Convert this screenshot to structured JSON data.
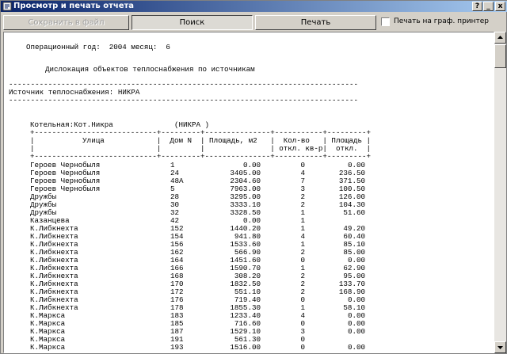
{
  "window": {
    "title": "Просмотр и печать отчета",
    "btn_help": "?",
    "btn_restore": "_",
    "btn_close": "x"
  },
  "toolbar": {
    "save_label": "Сохранить в файл",
    "search_label": "Поиск",
    "print_label": "Печать",
    "graph_printer_label": "Печать на граф. принтер"
  },
  "report": {
    "header_line": "Операционный год:  2004 месяц:  6",
    "title_line": "Дислокация объектов теплоснабжения по источникам",
    "sep_line": "--------------------------------------------------------------------------------",
    "source_line": "Источник теплоснабжения: НИКРА",
    "boiler_line": "Котельная:Кот.Никра              (НИКРА )",
    "table_border": "+----------------------------+---------+---------------+-----------+---------+",
    "table_head1": "|           Улица            |  Дом N  | Площадь, м2   |  Кол-во   | Площадь |",
    "table_head2": "|                            |         |               | откл. кв-р|  откл.  |",
    "rows": [
      [
        "Героев Чернобыля",
        "1",
        "0.00",
        "0",
        "0.00"
      ],
      [
        "Героев Чернобыля",
        "24",
        "3405.00",
        "4",
        "236.50"
      ],
      [
        "Героев Чернобыля",
        "48А",
        "2304.60",
        "7",
        "371.50"
      ],
      [
        "Героев Чернобыля",
        "5",
        "7963.00",
        "3",
        "100.50"
      ],
      [
        "Дружбы",
        "28",
        "3295.00",
        "2",
        "126.00"
      ],
      [
        "Дружбы",
        "30",
        "3333.10",
        "2",
        "104.30"
      ],
      [
        "Дружбы",
        "32",
        "3328.50",
        "1",
        "51.60"
      ],
      [
        "Казанцева",
        "42",
        "0.00",
        "1",
        ""
      ],
      [
        "К.Либкнехта",
        "152",
        "1440.20",
        "1",
        "49.20"
      ],
      [
        "К.Либкнехта",
        "154",
        "941.80",
        "4",
        "60.40"
      ],
      [
        "К.Либкнехта",
        "156",
        "1533.60",
        "1",
        "85.10"
      ],
      [
        "К.Либкнехта",
        "162",
        "566.90",
        "2",
        "85.00"
      ],
      [
        "К.Либкнехта",
        "164",
        "1451.60",
        "0",
        "0.00"
      ],
      [
        "К.Либкнехта",
        "166",
        "1590.70",
        "1",
        "62.90"
      ],
      [
        "К.Либкнехта",
        "168",
        "308.20",
        "2",
        "95.00"
      ],
      [
        "К.Либкнехта",
        "170",
        "1832.50",
        "2",
        "133.70"
      ],
      [
        "К.Либкнехта",
        "172",
        "551.10",
        "2",
        "168.90"
      ],
      [
        "К.Либкнехта",
        "176",
        "719.40",
        "0",
        "0.00"
      ],
      [
        "К.Либкнехта",
        "178",
        "1855.30",
        "1",
        "58.10"
      ],
      [
        "К.Маркса",
        "183",
        "1233.40",
        "4",
        "0.00"
      ],
      [
        "К.Маркса",
        "185",
        "716.60",
        "0",
        "0.00"
      ],
      [
        "К.Маркса",
        "187",
        "1529.10",
        "3",
        "0.00"
      ],
      [
        "К.Маркса",
        "191",
        "561.30",
        "0",
        ""
      ],
      [
        "К.Маркса",
        "193",
        "1516.00",
        "0",
        "0.00"
      ]
    ]
  }
}
